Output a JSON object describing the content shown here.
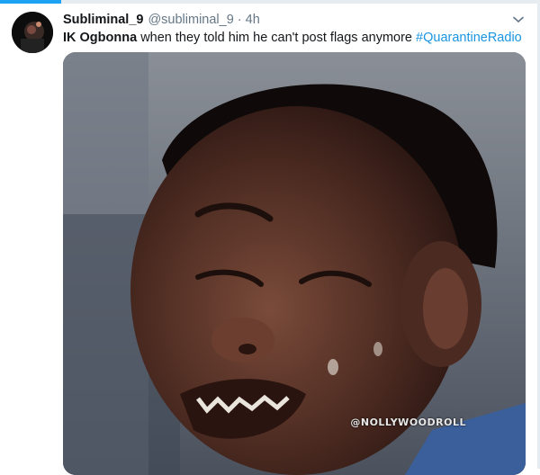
{
  "tweet": {
    "display_name": "Subliminal_9",
    "handle": "@subliminal_9",
    "separator": "·",
    "time": "4h",
    "text_bold": "IK Ogbonna",
    "text_body": " when they told him he can't post flags anymore ",
    "hashtag": "#QuarantineRadio",
    "media": {
      "description_icon": "crying-child-photo",
      "watermark": "@NOLLYWOODROLL"
    }
  },
  "colors": {
    "accent": "#1da1f2",
    "hashtag": "#1b95e0",
    "muted": "#657786",
    "text": "#14171a"
  }
}
